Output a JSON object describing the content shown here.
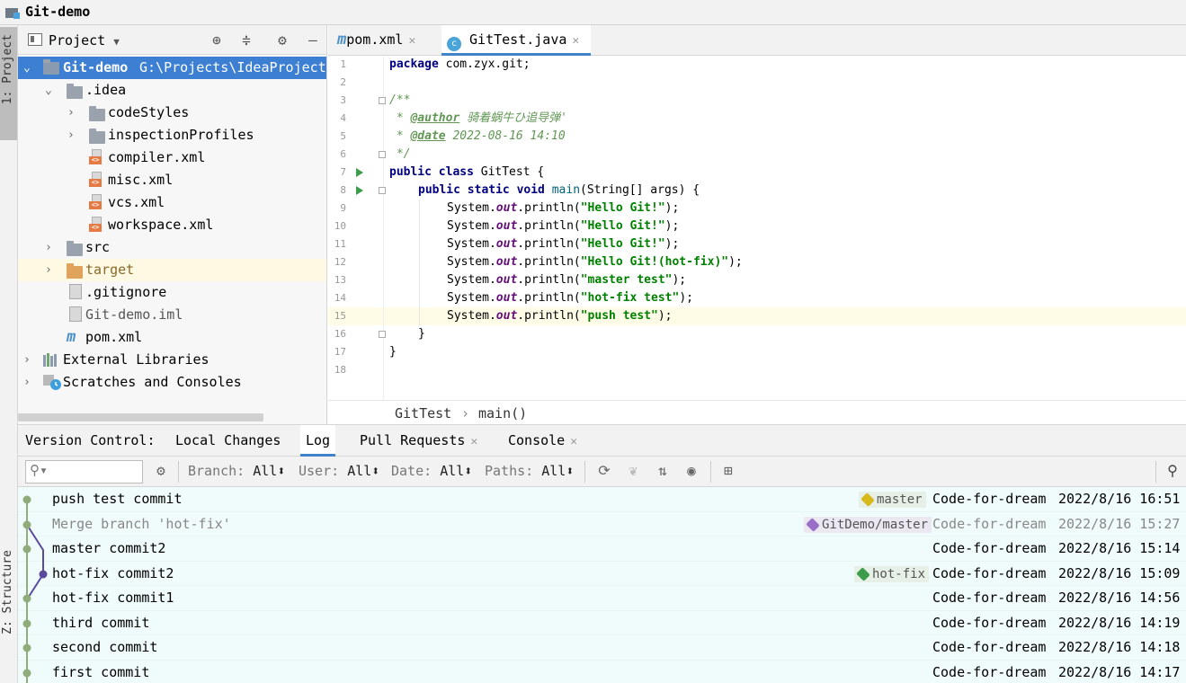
{
  "window": {
    "title": "Git-demo"
  },
  "left_stripe": {
    "project_tab": "1: Project",
    "structure_tab": "Z: Structure"
  },
  "project_panel": {
    "title": "Project",
    "tree": [
      {
        "label": "Git-demo",
        "path": "G:\\Projects\\IdeaProjects",
        "icon": "module-folder-icon",
        "expanded": true,
        "selected": true
      },
      {
        "label": ".idea",
        "icon": "folder-icon",
        "expanded": true
      },
      {
        "label": "codeStyles",
        "icon": "folder-icon"
      },
      {
        "label": "inspectionProfiles",
        "icon": "folder-icon"
      },
      {
        "label": "compiler.xml",
        "icon": "xml-file-icon"
      },
      {
        "label": "misc.xml",
        "icon": "xml-file-icon"
      },
      {
        "label": "vcs.xml",
        "icon": "xml-file-icon"
      },
      {
        "label": "workspace.xml",
        "icon": "xml-file-icon"
      },
      {
        "label": "src",
        "icon": "folder-icon"
      },
      {
        "label": "target",
        "icon": "excluded-folder-icon",
        "highlighted": true
      },
      {
        "label": ".gitignore",
        "icon": "ignore-file-icon"
      },
      {
        "label": "Git-demo.iml",
        "icon": "iml-file-icon"
      },
      {
        "label": "pom.xml",
        "icon": "maven-icon"
      },
      {
        "label": "External Libraries",
        "icon": "libraries-icon"
      },
      {
        "label": "Scratches and Consoles",
        "icon": "scratches-icon"
      }
    ]
  },
  "editor": {
    "tabs": [
      {
        "label": "pom.xml",
        "icon": "maven-icon",
        "active": false
      },
      {
        "label": "GitTest.java",
        "icon": "java-class-icon",
        "active": true
      }
    ],
    "line_numbers": [
      "1",
      "2",
      "3",
      "4",
      "5",
      "6",
      "7",
      "8",
      "9",
      "10",
      "11",
      "12",
      "13",
      "14",
      "15",
      "16",
      "17",
      "18"
    ],
    "code": {
      "l1_kw": "package",
      "l1_rest": " com.zyx.git;",
      "l3": "/**",
      "l4_star": " * ",
      "l4_tag": "@author",
      "l4_val": " 骑着蜗牛ひ追导弹'",
      "l5_star": " * ",
      "l5_tag": "@date",
      "l5_val": " 2022-08-16 14:10",
      "l6": " */",
      "l7_kw": "public class",
      "l7_rest": " GitTest {",
      "l8_kw": "public static void",
      "l8_m": "main",
      "l8_rest": "(String[] args) {",
      "sys": "System.",
      "out": "out",
      "println": ".println(",
      "close": ");",
      "strings": [
        "\"Hello Git!\"",
        "\"Hello Git!\"",
        "\"Hello Git!\"",
        "\"Hello Git!(hot-fix)\"",
        "\"master test\"",
        "\"hot-fix test\"",
        "\"push test\""
      ],
      "l16": "}",
      "l17": "}"
    },
    "breadcrumb": {
      "class": "GitTest",
      "sep": "›",
      "method": "main()"
    }
  },
  "bottom": {
    "label": "Version Control:",
    "tabs": [
      {
        "label": "Local Changes",
        "closable": false
      },
      {
        "label": "Log",
        "closable": false,
        "active": true
      },
      {
        "label": "Pull Requests",
        "closable": true
      },
      {
        "label": "Console",
        "closable": true
      }
    ],
    "filters": [
      {
        "name": "Branch:",
        "value": "All"
      },
      {
        "name": "User:",
        "value": "All"
      },
      {
        "name": "Date:",
        "value": "All"
      },
      {
        "name": "Paths:",
        "value": "All"
      }
    ],
    "commits": [
      {
        "message": "push test commit",
        "tag": "master",
        "tag_color": "#d6b91a",
        "author": "Code-for-dream",
        "date": "2022/8/16 16:51"
      },
      {
        "message": "Merge branch 'hot-fix'",
        "tag": "GitDemo/master",
        "tag_color": "#9a6fc7",
        "author": "Code-for-dream",
        "date": "2022/8/16 15:27",
        "dim": true
      },
      {
        "message": "master commit2",
        "author": "Code-for-dream",
        "date": "2022/8/16 15:14"
      },
      {
        "message": "hot-fix commit2",
        "tag": "hot-fix",
        "tag_color": "#3d9c4a",
        "author": "Code-for-dream",
        "date": "2022/8/16 15:09"
      },
      {
        "message": "hot-fix commit1",
        "author": "Code-for-dream",
        "date": "2022/8/16 14:56"
      },
      {
        "message": "third commit",
        "author": "Code-for-dream",
        "date": "2022/8/16 14:19"
      },
      {
        "message": "second commit",
        "author": "Code-for-dream",
        "date": "2022/8/16 14:18"
      },
      {
        "message": "first commit",
        "author": "Code-for-dream",
        "date": "2022/8/16 14:17"
      }
    ]
  },
  "colors": {
    "accent": "#4083c9",
    "selection": "#3d7fd3",
    "graph_main": "#8fac7a",
    "graph_branch": "#5a4a9c"
  }
}
